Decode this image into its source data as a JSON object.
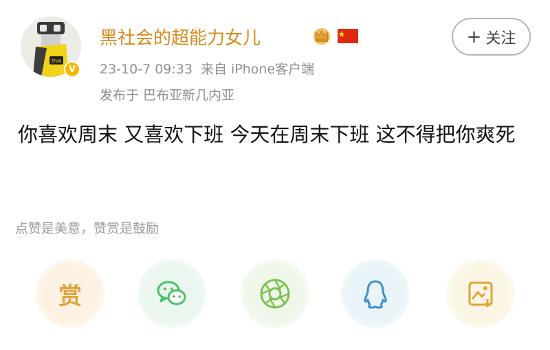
{
  "post": {
    "username": "黑社会的超能力女儿",
    "date": "23-10-7 09:33",
    "source": "来自 iPhone客户端",
    "location": "发布于 巴布亚新几内亚",
    "text": "你喜欢周末 又喜欢下班 今天在周末下班 这不得把你爽死",
    "follow_label": "关注",
    "follow_plus": "+",
    "badge": "V"
  },
  "reward": {
    "hint": "点赞是美意，赞赏是鼓励",
    "reward_label": "赏"
  },
  "actions": [
    {
      "name": "reward",
      "icon": "reward-icon"
    },
    {
      "name": "wechat",
      "icon": "wechat-icon"
    },
    {
      "name": "moments",
      "icon": "moments-icon"
    },
    {
      "name": "qq",
      "icon": "qq-icon"
    },
    {
      "name": "save-image",
      "icon": "save-image-icon"
    }
  ],
  "colors": {
    "username": "#d98a1c",
    "meta": "#8f8f8f",
    "reward": "#e0a43a",
    "wechat": "#4cbf6b",
    "moments": "#7cc250",
    "qq": "#3a8fd1",
    "save": "#e0a43a"
  }
}
